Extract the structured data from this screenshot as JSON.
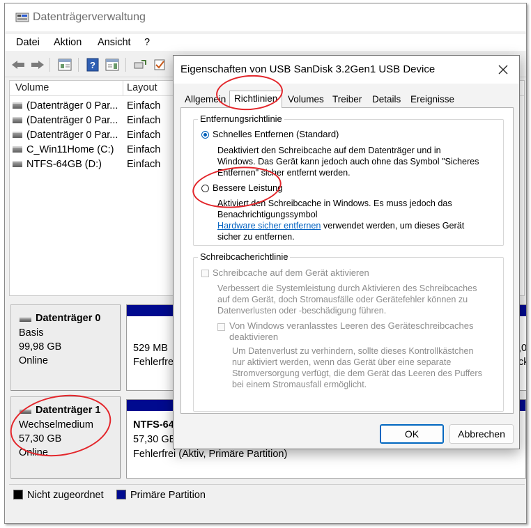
{
  "window": {
    "title": "Datenträgerverwaltung"
  },
  "menu": [
    "Datei",
    "Aktion",
    "Ansicht",
    "?"
  ],
  "toolbar": {
    "buttons": [
      "back-icon",
      "forward-icon",
      "console-tree-icon",
      "help-icon",
      "properties-icon",
      "rescan-icon",
      "check-icon"
    ]
  },
  "volume_list": {
    "columns": [
      "Volume",
      "Layout"
    ],
    "rows": [
      {
        "name": "(Datenträger 0 Par...",
        "layout": "Einfach"
      },
      {
        "name": "(Datenträger 0 Par...",
        "layout": "Einfach"
      },
      {
        "name": "(Datenträger 0 Par...",
        "layout": "Einfach"
      },
      {
        "name": "C_Win11Home (C:)",
        "layout": "Einfach"
      },
      {
        "name": "NTFS-64GB (D:)",
        "layout": "Einfach"
      }
    ]
  },
  "disks": [
    {
      "name": "Datenträger 0",
      "type": "Basis",
      "size": "99,98 GB",
      "status": "Online",
      "partition": {
        "size": "529 MB",
        "status": "Fehlerfrei"
      },
      "right_edge_size": ",0",
      "right_edge_status": "ck"
    },
    {
      "name": "Datenträger 1",
      "type": "Wechselmedium",
      "size": "57,30 GB",
      "status": "Online",
      "partition": {
        "name": "NTFS-64G",
        "size": "57,30 GB",
        "status": "Fehlerfrei (Aktiv, Primäre Partition)"
      }
    }
  ],
  "legend": [
    {
      "label": "Nicht zugeordnet",
      "color": "#000000"
    },
    {
      "label": "Primäre Partition",
      "color": "#000a8f"
    }
  ],
  "dialog": {
    "title": "Eigenschaften von  USB  SanDisk 3.2Gen1 USB Device",
    "tabs": [
      "Allgemein",
      "Richtlinien",
      "Volumes",
      "Treiber",
      "Details",
      "Ereignisse"
    ],
    "active_tab": "Richtlinien",
    "removal_policy": {
      "title": "Entfernungsrichtlinie",
      "option_quick": {
        "label": "Schnelles Entfernen (Standard)",
        "selected": true,
        "desc": [
          "Deaktiviert den Schreibcache auf dem Datenträger und in",
          "Windows. Das Gerät kann jedoch auch ohne das Symbol \"Sicheres",
          "Entfernen\" sicher entfernt werden."
        ]
      },
      "option_performance": {
        "label": "Bessere Leistung",
        "selected": false,
        "desc": [
          "Aktiviert den Schreibcache in Windows. Es muss jedoch das",
          "Benachrichtigungssymbol"
        ],
        "link": "Hardware sicher entfernen",
        "desc_after_link": " verwendet werden, um dieses Gerät",
        "desc_last": "sicher zu entfernen."
      }
    },
    "write_cache_policy": {
      "title": "Schreibcacherichtlinie",
      "enable_cache": {
        "label": "Schreibcache auf dem Gerät aktivieren",
        "checked": false,
        "desc": [
          "Verbessert die Systemleistung durch Aktivieren des Schreibcaches",
          "auf dem Gerät, doch Stromausfälle oder Gerätefehler können zu",
          "Datenverlusten oder -beschädigung führen."
        ]
      },
      "disable_flush": {
        "label_lines": [
          "Von Windows veranlasstes Leeren des Geräteschreibcaches",
          "deaktivieren"
        ],
        "checked": false,
        "desc": [
          "Um Datenverlust zu verhindern, sollte dieses Kontrollkästchen",
          "nur aktiviert werden, wenn das Gerät über eine separate",
          "Stromversorgung verfügt, die dem Gerät das Leeren des Puffers",
          "bei einem Stromausfall ermöglicht."
        ]
      }
    },
    "ok_label": "OK",
    "cancel_label": "Abbrechen"
  },
  "annotation_color": "#e3262b"
}
